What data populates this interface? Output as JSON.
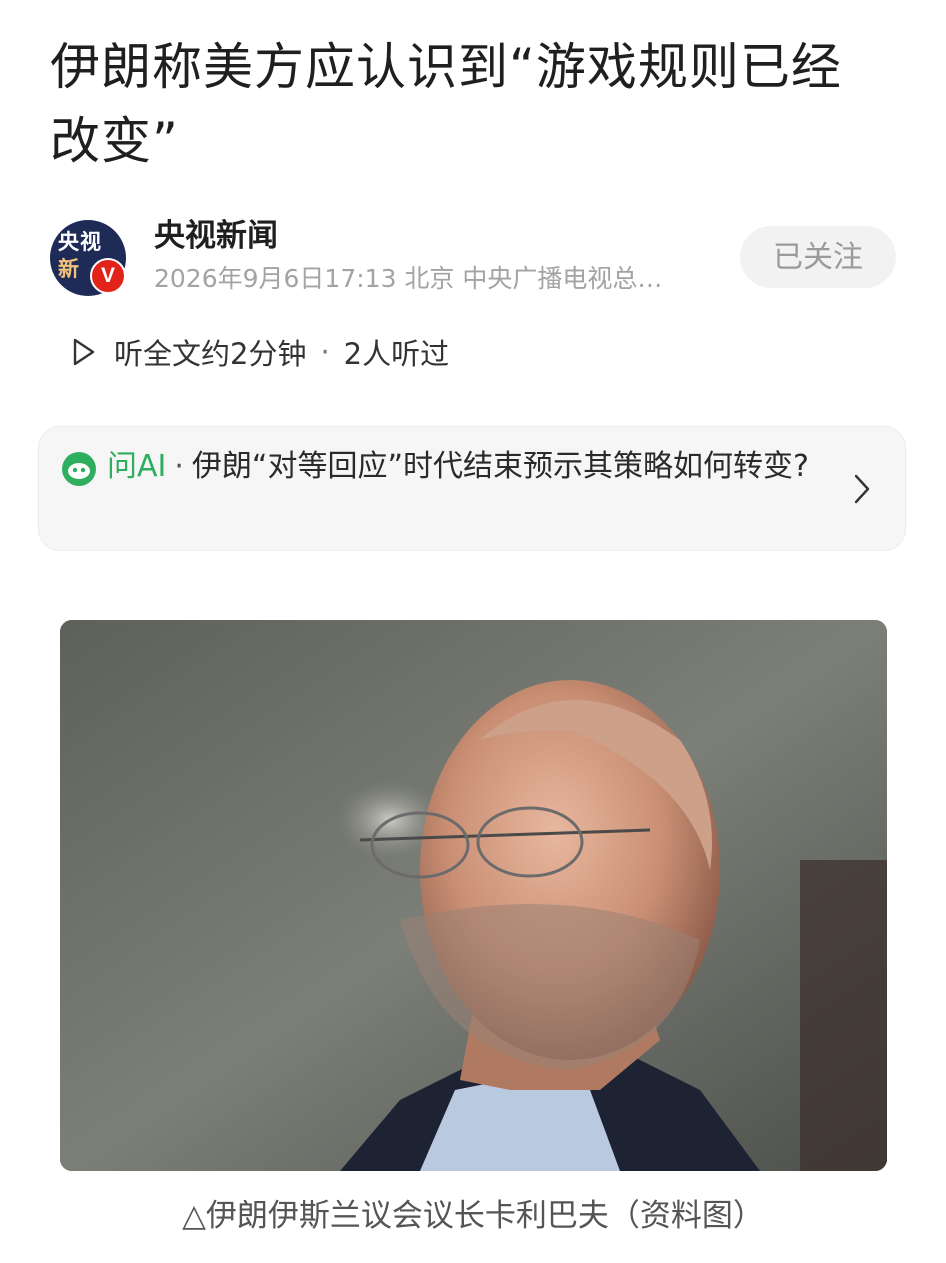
{
  "article": {
    "title": "伊朗称美方应认识到“游戏规则已经改变”"
  },
  "author": {
    "avatar_line1": "央视",
    "avatar_line2": "新",
    "badge": "V",
    "name": "央视新闻",
    "meta": "2026年9月6日17:13 北京 中央广播电视总…",
    "follow_label": "已关注"
  },
  "listen": {
    "icon": "play-icon",
    "text": "听全文约2分钟",
    "separator": "·",
    "count": "2人听过"
  },
  "ask_ai": {
    "icon": "ai-face-icon",
    "label": "问AI",
    "separator": "·",
    "question": "伊朗“对等回应”时代结束预示其策略如何转变?",
    "accent_color": "#2fae5f"
  },
  "photo": {
    "caption": "△伊朗伊斯兰议会议长卡利巴夫（资料图）"
  }
}
